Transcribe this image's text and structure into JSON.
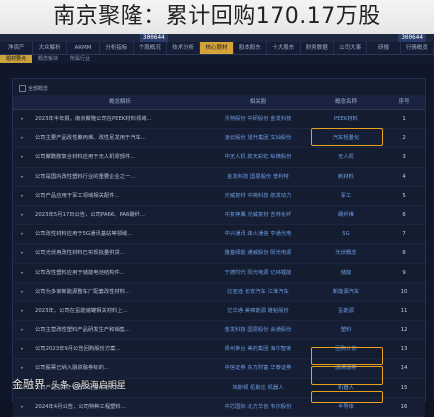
{
  "headline": "南京聚隆：累计回购170.17万股",
  "app": {
    "code_left": "300644",
    "code_right": "300644",
    "tabs": [
      "净资产",
      "大众解析",
      "ARMM",
      "分析指标",
      "个股概况",
      "技术分析",
      "核心题材",
      "股本股东",
      "十大股东",
      "财务数据",
      "公司大事",
      "研报",
      "行情概览"
    ],
    "active_tab": "核心题材",
    "subtabs": [
      "题材要点",
      "概念板块",
      "所属行业"
    ],
    "active_subtab": "题材要点",
    "filter_label": "全部概念",
    "columns": {
      "num": "序号",
      "name": "概念名称",
      "concept": "相关股",
      "desc": "概念解析"
    },
    "rows": [
      {
        "num": "1",
        "name": "PEEK材料",
        "concept": "沃特股份 中研股份 金发科技",
        "desc": "2023年半年报，南京聚隆公司在PEEK材料领域..."
      },
      {
        "num": "2",
        "name": "汽车轻量化",
        "concept": "凌云股份 旭升集团 文灿股份",
        "desc": "公司主要产品改性聚丙烯、改性尼龙用于汽车..."
      },
      {
        "num": "3",
        "name": "无人机",
        "concept": "中无人机 航天彩虹 纵横股份",
        "desc": "公司聚酰胺复合材料应用于无人机零部件..."
      },
      {
        "num": "4",
        "name": "新材料",
        "concept": "金发科技 国恩股份 普利特",
        "desc": "公司是国内改性塑料行业的重要企业之一..."
      },
      {
        "num": "5",
        "name": "军工",
        "concept": "光威复材 中简科技 航发动力",
        "desc": "公司产品应用于军工领域相关配件..."
      },
      {
        "num": "6",
        "name": "碳纤维",
        "concept": "中复神鹰 光威复材 吉林化纤",
        "desc": "2023年5月17日公告，公司PA66、PA6碳纤..."
      },
      {
        "num": "7",
        "name": "5G",
        "concept": "中兴通讯 烽火通信 亨通光电",
        "desc": "公司改性材料应用于5G通讯基站等领域..."
      },
      {
        "num": "8",
        "name": "光伏概念",
        "concept": "隆基绿能 通威股份 阳光电源",
        "desc": "公司光伏用改性材料已实现批量供货..."
      },
      {
        "num": "9",
        "name": "储能",
        "concept": "宁德时代 阳光电源 亿纬锂能",
        "desc": "公司改性塑料应用于储能电池结构件..."
      },
      {
        "num": "10",
        "name": "新能源汽车",
        "concept": "比亚迪 长安汽车 江淮汽车",
        "desc": "公司为多家新能源整车厂配套改性材料..."
      },
      {
        "num": "11",
        "name": "氢能源",
        "concept": "亿华通 美锦能源 雄韬股份",
        "desc": "2023年，公司在氢能储罐相关材料上..."
      },
      {
        "num": "12",
        "name": "塑料",
        "concept": "金发科技 国恩股份 会通股份",
        "desc": "公司主营改性塑料产品研发生产和销售..."
      },
      {
        "num": "13",
        "name": "回购计划",
        "concept": "贵州茅台 美的集团 海尔智家",
        "desc": "公司2023年9月公告回购股份方案..."
      },
      {
        "num": "14",
        "name": "融资融券",
        "concept": "中信证券 东方财富 华泰证券",
        "desc": "公司股票已纳入融资融券标的..."
      },
      {
        "num": "15",
        "name": "机器人",
        "concept": "埃斯顿 拓斯达 机器人",
        "desc": "公司产品应用于机器人轻量化结构件..."
      },
      {
        "num": "16",
        "name": "半导体",
        "concept": "中芯国际 北方华创 韦尔股份",
        "desc": "2024年4月公告，公司特种工程塑料..."
      }
    ]
  },
  "watermark": {
    "brand": "金融界",
    "source": "头条 @股海启明星"
  }
}
